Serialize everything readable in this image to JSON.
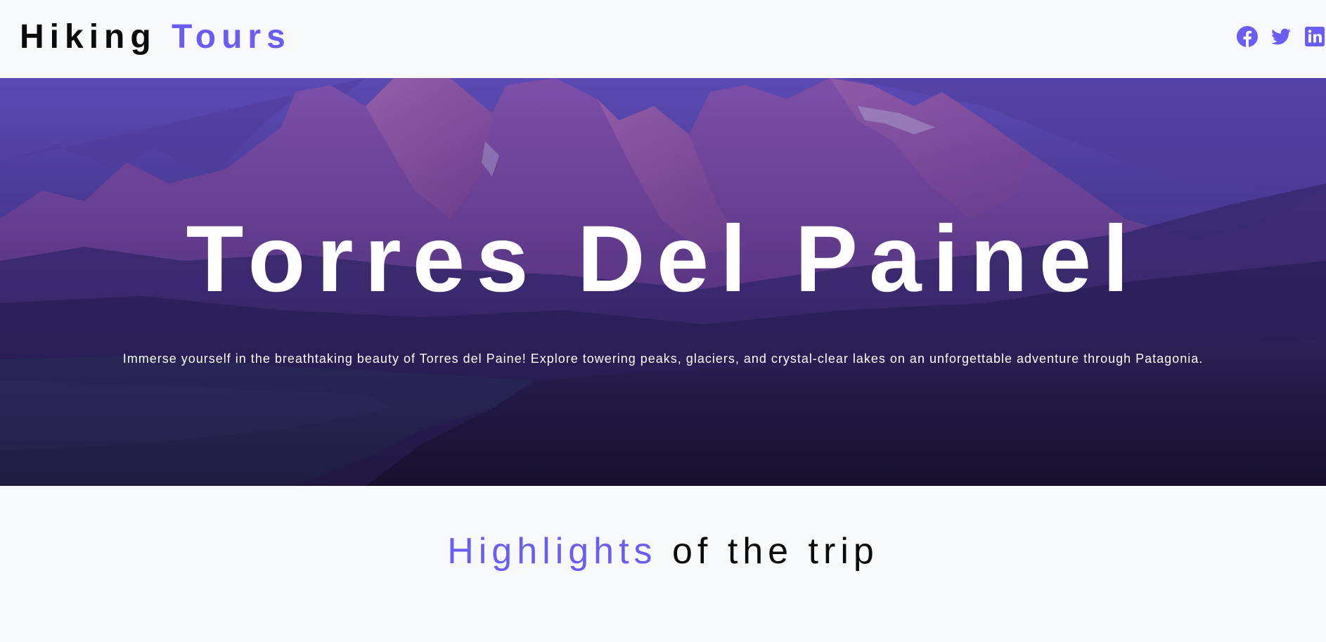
{
  "header": {
    "logo_part1": "Hiking",
    "logo_part2": "Tours",
    "socials": [
      {
        "name": "facebook",
        "icon": "facebook-icon"
      },
      {
        "name": "twitter",
        "icon": "twitter-icon"
      },
      {
        "name": "linkedin",
        "icon": "linkedin-icon"
      }
    ]
  },
  "hero": {
    "title": "Torres Del Painel",
    "description": "Immerse yourself in the breathtaking beauty of Torres del Paine! Explore towering peaks, glaciers, and crystal-clear lakes on an unforgettable adventure through Patagonia."
  },
  "highlights": {
    "title_accent": "Highlights",
    "title_rest": "of the trip"
  },
  "colors": {
    "accent": "#6b5cf6",
    "background": "#f8f9fb",
    "text": "#0b0b0b",
    "hero_overlay": "#3b2a85"
  }
}
